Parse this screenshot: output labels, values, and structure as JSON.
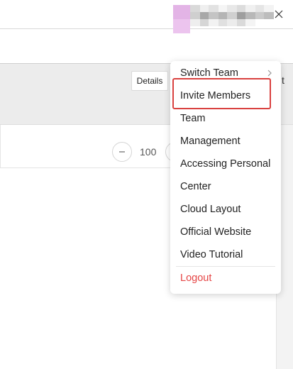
{
  "toolbar": {
    "details_label": "Details",
    "partial_text": "t",
    "zoom_value": "100"
  },
  "user_menu": {
    "items": [
      {
        "label": "Switch Team",
        "has_submenu": true
      },
      {
        "label": "Invite Members",
        "highlighted": true
      },
      {
        "label": "Team"
      },
      {
        "label": "Management"
      },
      {
        "label": "Accessing Personal"
      },
      {
        "label": "Center"
      },
      {
        "label": "Cloud Layout"
      },
      {
        "label": "Official Website"
      },
      {
        "label": "Video Tutorial"
      },
      {
        "label": "Logout"
      }
    ]
  },
  "colors": {
    "highlight": "#d9413f",
    "logout": "#e54545",
    "avatar": "#e3b4e6"
  },
  "icons": {
    "minimize": "minimize-icon",
    "maximize": "restore-icon",
    "close": "close-icon",
    "submenu": "chevron-right-icon",
    "zoom_out": "minus-icon"
  }
}
